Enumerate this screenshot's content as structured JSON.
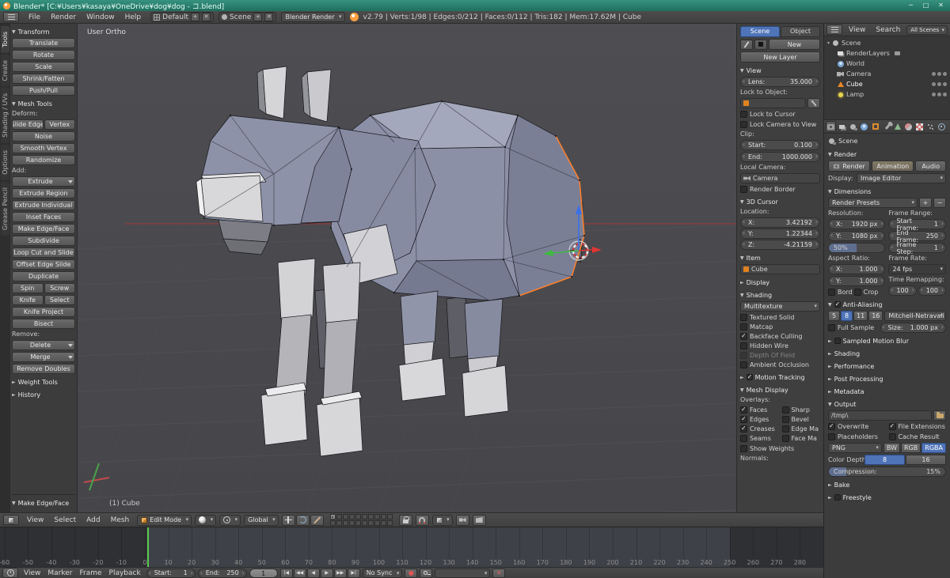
{
  "window": {
    "title": "Blender* [C:¥Users¥kasaya¥OneDrive¥dog¥dog - コ.blend]",
    "minimize": "─",
    "maximize": "□",
    "close": "✕"
  },
  "icons": {
    "add": "+",
    "remove": "−",
    "close": "✕",
    "record": "●",
    "unlink": "✕"
  },
  "colors": {
    "accent_blue": "#4f74b8",
    "selection_orange": "#ff7f2a",
    "axis_red": "#cc3333",
    "axis_green": "#3fba3f",
    "axis_blue": "#3a6fe8",
    "current_frame_green": "#5ccc50"
  },
  "infobar": {
    "menus": [
      "File",
      "Render",
      "Window",
      "Help"
    ],
    "layout_name": "Default",
    "scene_name": "Scene",
    "engine": "Blender Render",
    "stats": "v2.79 | Verts:1/98 | Edges:0/212 | Faces:0/112 | Tris:182 | Mem:17.62M | Cube"
  },
  "toolshelf": {
    "tabs": [
      {
        "label": "Tools",
        "active": true
      },
      {
        "label": "Create",
        "active": false
      },
      {
        "label": "Shading / UVs",
        "active": false
      },
      {
        "label": "Options",
        "active": false
      },
      {
        "label": "Grease Pencil",
        "active": false
      }
    ],
    "items": [
      {
        "t": "header",
        "label": "Transform",
        "open": true
      },
      {
        "t": "btn",
        "label": "Translate"
      },
      {
        "t": "btn",
        "label": "Rotate"
      },
      {
        "t": "btn",
        "label": "Scale"
      },
      {
        "t": "btn",
        "label": "Shrink/Fatten"
      },
      {
        "t": "btn",
        "label": "Push/Pull"
      },
      {
        "t": "header",
        "label": "Mesh Tools",
        "open": true
      },
      {
        "t": "label",
        "label": "Deform:"
      },
      {
        "t": "row",
        "labels": [
          "Slide Edge",
          "Vertex"
        ]
      },
      {
        "t": "btn",
        "label": "Noise"
      },
      {
        "t": "btn",
        "label": "Smooth Vertex"
      },
      {
        "t": "btn",
        "label": "Randomize"
      },
      {
        "t": "label",
        "label": "Add:"
      },
      {
        "t": "menu",
        "label": "Extrude"
      },
      {
        "t": "btn",
        "label": "Extrude Region"
      },
      {
        "t": "btn",
        "label": "Extrude Individual"
      },
      {
        "t": "btn",
        "label": "Inset Faces"
      },
      {
        "t": "btn",
        "label": "Make Edge/Face"
      },
      {
        "t": "btn",
        "label": "Subdivide"
      },
      {
        "t": "btn",
        "label": "Loop Cut and Slide"
      },
      {
        "t": "btn",
        "label": "Offset Edge Slide"
      },
      {
        "t": "btn",
        "label": "Duplicate"
      },
      {
        "t": "row",
        "labels": [
          "Spin",
          "Screw"
        ]
      },
      {
        "t": "row",
        "labels": [
          "Knife",
          "Select"
        ]
      },
      {
        "t": "btn",
        "label": "Knife Project"
      },
      {
        "t": "btn",
        "label": "Bisect"
      },
      {
        "t": "label",
        "label": "Remove:"
      },
      {
        "t": "menu",
        "label": "Delete"
      },
      {
        "t": "menu",
        "label": "Merge"
      },
      {
        "t": "btn",
        "label": "Remove Doubles"
      },
      {
        "t": "header",
        "label": "Weight Tools",
        "open": false
      },
      {
        "t": "header",
        "label": "History",
        "open": false
      }
    ],
    "operator_panel": "Make Edge/Face"
  },
  "viewport": {
    "view_label": "User Ortho",
    "object_label": "(1) Cube"
  },
  "npanel": {
    "tabs": [
      {
        "label": "Scene",
        "active": true
      },
      {
        "label": "Object",
        "active": false
      }
    ],
    "new_button": "New",
    "new_layer_button": "New Layer",
    "view": {
      "title": "View",
      "lens_label": "Lens:",
      "lens_value": "35.000",
      "lock_object_label": "Lock to Object:",
      "lock_cursor": "Lock to Cursor",
      "lock_camera": "Lock Camera to View",
      "clip_label": "Clip:",
      "clip_start_label": "Start:",
      "clip_start_value": "0.100",
      "clip_end_label": "End:",
      "clip_end_value": "1000.000",
      "local_camera_label": "Local Camera:",
      "camera_value": "Camera",
      "render_border": "Render Border"
    },
    "cursor": {
      "title": "3D Cursor",
      "location_label": "Location:",
      "coords": [
        {
          "axis": "X:",
          "value": "3.42192"
        },
        {
          "axis": "Y:",
          "value": "1.22344"
        },
        {
          "axis": "Z:",
          "value": "-4.21159"
        }
      ]
    },
    "item": {
      "title": "Item",
      "name": "Cube"
    },
    "display_title": "Display",
    "shading": {
      "title": "Shading",
      "mode": "Multitexture",
      "options": [
        {
          "label": "Textured Solid",
          "checked": false,
          "disabled": false
        },
        {
          "label": "Matcap",
          "checked": false,
          "disabled": false
        },
        {
          "label": "Backface Culling",
          "checked": true,
          "disabled": false
        },
        {
          "label": "Hidden Wire",
          "checked": false,
          "disabled": false
        },
        {
          "label": "Depth Of Field",
          "checked": false,
          "disabled": true
        },
        {
          "label": "Ambient Occlusion",
          "checked": false,
          "disabled": false
        }
      ]
    },
    "motion_tracking": {
      "title": "Motion Tracking",
      "checked": true
    },
    "mesh_display": {
      "title": "Mesh Display",
      "overlays_label": "Overlays:",
      "left_options": [
        {
          "label": "Faces",
          "checked": true
        },
        {
          "label": "Edges",
          "checked": true
        },
        {
          "label": "Creases",
          "checked": true
        },
        {
          "label": "Seams",
          "checked": false
        }
      ],
      "right_options": [
        {
          "label": "Sharp",
          "checked": false
        },
        {
          "label": "Bevel",
          "checked": false
        },
        {
          "label": "Edge Ma",
          "checked": false
        },
        {
          "label": "Face Ma",
          "checked": false
        }
      ],
      "show_weights": {
        "label": "Show Weights",
        "checked": false
      },
      "normals_label": "Normals:"
    }
  },
  "outliner": {
    "menus": [
      "View",
      "Search"
    ],
    "scenes_filter": "All Scenes",
    "root_label": "Scene",
    "items": [
      {
        "label": "RenderLayers",
        "icon": "oi-layers",
        "extra": true,
        "toggles": false,
        "selected": false
      },
      {
        "label": "World",
        "icon": "oi-world",
        "extra": false,
        "toggles": false,
        "selected": false
      },
      {
        "label": "Camera",
        "icon": "oi-camera",
        "extra": false,
        "toggles": true,
        "selected": false
      },
      {
        "label": "Cube",
        "icon": "oi-mesh",
        "extra": false,
        "toggles": true,
        "selected": true
      },
      {
        "label": "Lamp",
        "icon": "oi-lamp",
        "extra": false,
        "toggles": true,
        "selected": false
      }
    ]
  },
  "properties": {
    "tabs": [
      {
        "name": "render-tab-icon",
        "kind": "ic-camera",
        "active": true
      },
      {
        "name": "render-layers-tab-icon",
        "kind": "ic-layers",
        "active": false
      },
      {
        "name": "scene-tab-icon",
        "kind": "ic-scene",
        "active": false
      },
      {
        "name": "world-tab-icon",
        "kind": "ic-world",
        "active": false
      },
      {
        "name": "object-tab-icon",
        "kind": "ic-object",
        "active": false
      },
      {
        "name": "modifiers-tab-icon",
        "kind": "ic-wrench",
        "active": false
      },
      {
        "name": "object-data-tab-icon",
        "kind": "ic-data",
        "active": false
      },
      {
        "name": "material-tab-icon",
        "kind": "ic-material",
        "active": false
      },
      {
        "name": "texture-tab-icon",
        "kind": "ic-texture",
        "active": false
      },
      {
        "name": "particles-tab-icon",
        "kind": "ic-particles",
        "active": false
      },
      {
        "name": "physics-tab-icon",
        "kind": "ic-physics",
        "active": false
      }
    ],
    "breadcrumb": "Scene",
    "render": {
      "title": "Render",
      "render_button": "Render",
      "animation_button": "Animation",
      "audio_button": "Audio",
      "display_label": "Display:",
      "display_value": "Image Editor"
    },
    "dimensions": {
      "title": "Dimensions",
      "presets": "Render Presets",
      "resolution_label": "Resolution:",
      "frame_range_label": "Frame Range:",
      "res_x": {
        "label": "X:",
        "value": "1920 px"
      },
      "res_y": {
        "label": "Y:",
        "value": "1080 px"
      },
      "res_pct": "50%",
      "res_pct_fill": 50,
      "start_frame": {
        "label": "Start Frame:",
        "value": "1"
      },
      "end_frame": {
        "label": "End Frame:",
        "value": "250"
      },
      "frame_step": {
        "label": "Frame Step:",
        "value": "1"
      },
      "aspect_label": "Aspect Ratio:",
      "frame_rate_label": "Frame Rate:",
      "asp_x": {
        "label": "X:",
        "value": "1.000"
      },
      "asp_y": {
        "label": "Y:",
        "value": "1.000"
      },
      "fps": "24 fps",
      "border_check": "Bord",
      "crop_check": "Crop",
      "time_remap_label": "Time Remapping:",
      "remap_a": "100",
      "remap_b": "100"
    },
    "antialiasing": {
      "title": "Anti-Aliasing",
      "checked": true,
      "samples": [
        {
          "label": "5",
          "active": false
        },
        {
          "label": "8",
          "active": true
        },
        {
          "label": "11",
          "active": false
        },
        {
          "label": "16",
          "active": false
        }
      ],
      "filter": "Mitchell-Netravali",
      "full_sample": "Full Sample",
      "size": {
        "label": "Size:",
        "value": "1.000 px"
      }
    },
    "collapsed_a": [
      {
        "label": "Sampled Motion Blur",
        "has_check": true
      },
      {
        "label": "Shading",
        "has_check": false
      },
      {
        "label": "Performance",
        "has_check": false
      },
      {
        "label": "Post Processing",
        "has_check": false
      },
      {
        "label": "Metadata",
        "has_check": false
      }
    ],
    "output": {
      "title": "Output",
      "path": "/tmp\\",
      "checks": [
        {
          "label": "Overwrite",
          "checked": true
        },
        {
          "label": "File Extensions",
          "checked": true
        },
        {
          "label": "Placeholders",
          "checked": false
        },
        {
          "label": "Cache Result",
          "checked": false
        }
      ],
      "format": "PNG",
      "color_modes": [
        {
          "label": "BW",
          "active": false
        },
        {
          "label": "RGB",
          "active": false
        },
        {
          "label": "RGBA",
          "active": true
        }
      ],
      "color_depth_label": "Color Depth:",
      "depths": [
        {
          "label": "8",
          "active": true
        },
        {
          "label": "16",
          "active": false
        }
      ],
      "compression_label": "Compression:",
      "compression_value": "15%",
      "compression_pct": 15
    },
    "collapsed_b": [
      {
        "label": "Bake",
        "has_check": false
      },
      {
        "label": "Freestyle",
        "has_check": true
      }
    ]
  },
  "viewport_header": {
    "menus": [
      "View",
      "Select",
      "Add",
      "Mesh"
    ],
    "mode": "Edit Mode",
    "axis": "Global",
    "layer_count": 20,
    "active_layer": 0
  },
  "timeline": {
    "frame_labels": [
      -60,
      -50,
      -40,
      -30,
      -20,
      -10,
      0,
      10,
      20,
      30,
      40,
      50,
      60,
      70,
      80,
      90,
      100,
      110,
      120,
      130,
      140,
      150,
      160,
      170,
      180,
      190,
      200,
      210,
      220,
      230,
      240,
      250,
      260,
      270,
      280
    ],
    "range_start": 1,
    "range_end": 250,
    "menus": [
      "View",
      "Marker",
      "Frame",
      "Playback"
    ],
    "start": {
      "label": "Start:",
      "value": "1"
    },
    "end": {
      "label": "End:",
      "value": "250"
    },
    "current_frame": "1",
    "playback": [
      "|◀",
      "◀◀",
      "◀",
      "▶",
      "▶▶",
      "▶|"
    ],
    "sync": "No Sync"
  }
}
